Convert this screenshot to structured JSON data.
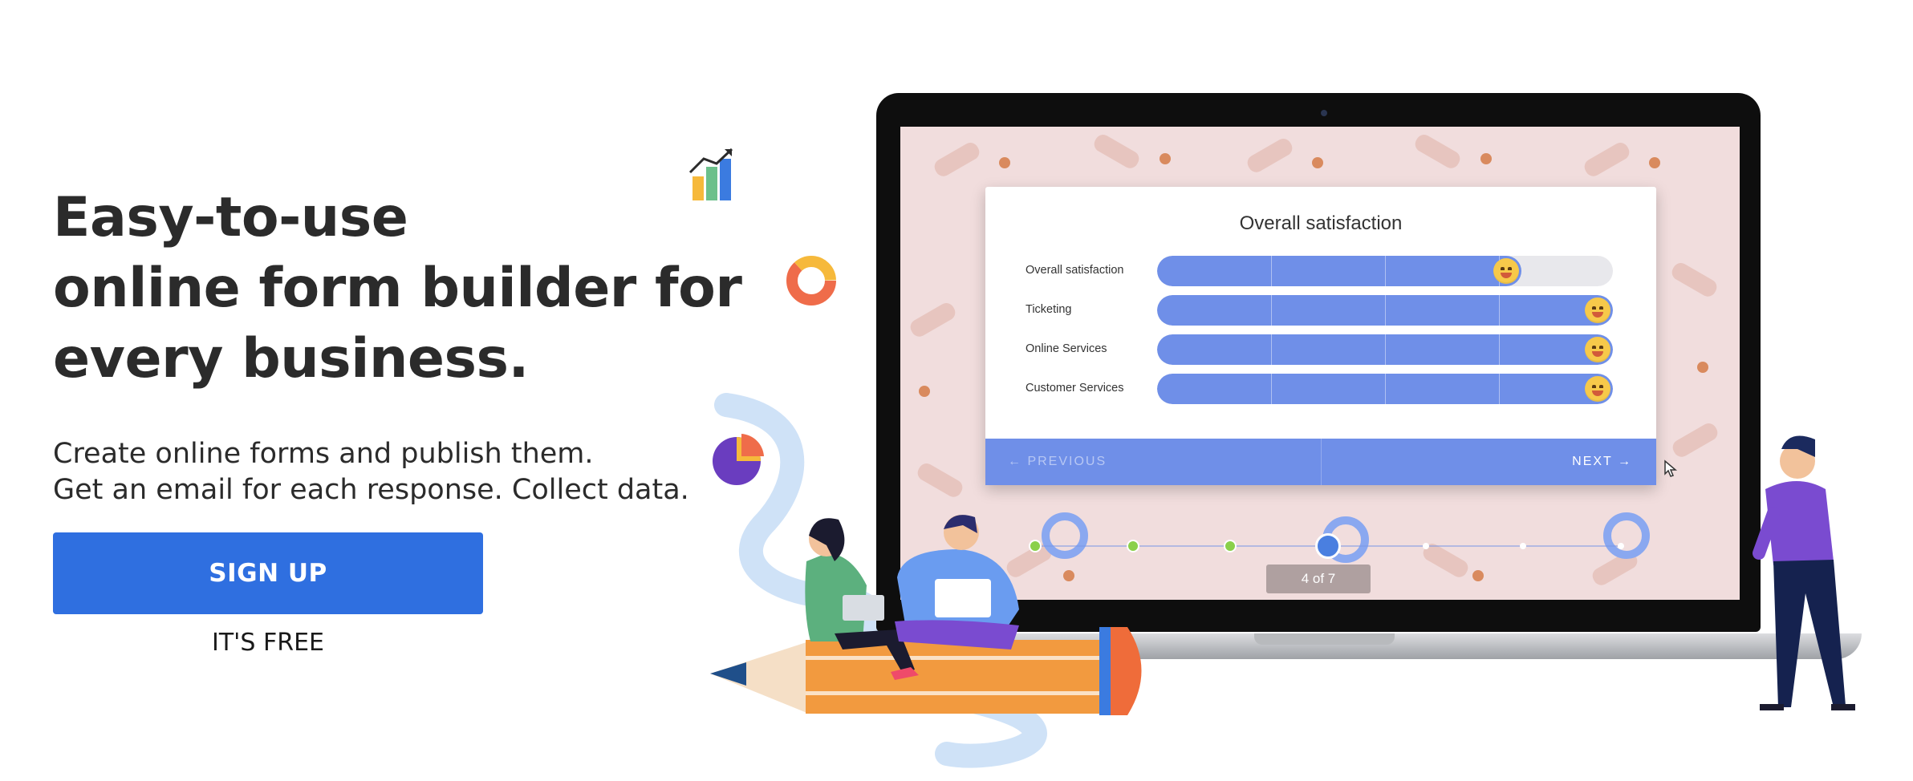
{
  "hero": {
    "headline_lines": [
      "Easy-to-use",
      "online form builder for",
      "every business."
    ],
    "subtext_lines": [
      "Create online forms and publish them.",
      "Get an email for each response. Collect data."
    ],
    "signup_label": "SIGN UP",
    "free_note": "IT'S FREE"
  },
  "form_preview": {
    "title": "Overall satisfaction",
    "rows": [
      {
        "label": "Overall satisfaction",
        "rating_fraction": 0.8
      },
      {
        "label": "Ticketing",
        "rating_fraction": 1.0
      },
      {
        "label": "Online Services",
        "rating_fraction": 1.0
      },
      {
        "label": "Customer Services",
        "rating_fraction": 1.0
      }
    ],
    "nav": {
      "previous_label": "PREVIOUS",
      "next_label": "NEXT"
    },
    "progress": {
      "current_page": 4,
      "total_pages": 7,
      "page_indicator": "4 of 7"
    }
  },
  "colors": {
    "primary_button": "#2f6fe0",
    "form_accent": "#6f8fe8",
    "screen_background": "#f1dddd",
    "headline_text": "#2b2b2b",
    "emoji_face": "#f7c94a"
  },
  "icons": [
    "bar-chart-icon",
    "donut-chart-icon",
    "pie-chart-icon",
    "arrow-left-icon",
    "arrow-right-icon",
    "cursor-icon"
  ]
}
